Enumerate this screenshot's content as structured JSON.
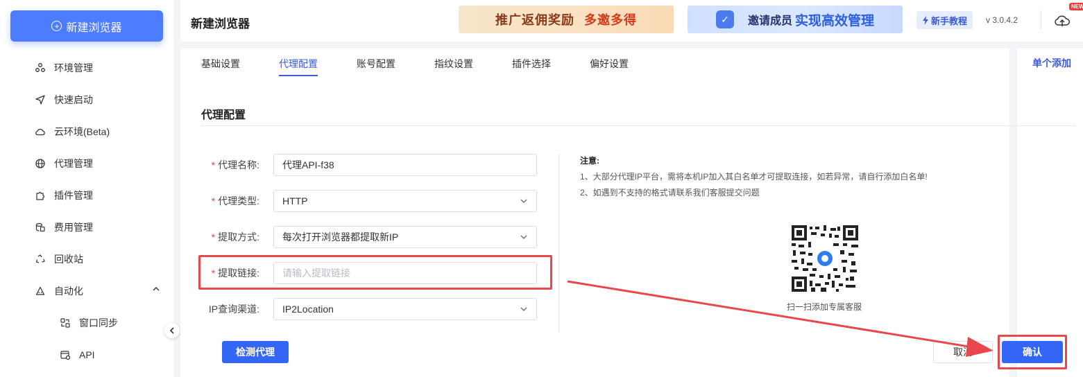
{
  "sidebar": {
    "new_browser_label": "新建浏览器",
    "items": [
      {
        "label": "环境管理",
        "icon": "cluster-icon"
      },
      {
        "label": "快速启动",
        "icon": "send-icon"
      },
      {
        "label": "云环境(Beta)",
        "icon": "cloud-icon"
      },
      {
        "label": "代理管理",
        "icon": "globe-icon"
      },
      {
        "label": "插件管理",
        "icon": "puzzle-icon"
      },
      {
        "label": "费用管理",
        "icon": "coins-icon"
      },
      {
        "label": "回收站",
        "icon": "recycle-icon"
      },
      {
        "label": "自动化",
        "icon": "robot-icon"
      }
    ],
    "sub_items": [
      {
        "label": "窗口同步",
        "icon": "window-sync-icon"
      },
      {
        "label": "API",
        "icon": "api-icon"
      }
    ]
  },
  "header": {
    "title": "新建浏览器",
    "banner1_a": "推广返佣奖励",
    "banner1_b": "多邀多得",
    "banner2_a": "邀请成员",
    "banner2_b": "实现高效管理",
    "tutorial": "新手教程",
    "version": "v 3.0.4.2",
    "new_badge": "NEW"
  },
  "tabs": [
    {
      "label": "基础设置",
      "active": false
    },
    {
      "label": "代理配置",
      "active": true
    },
    {
      "label": "账号配置",
      "active": false
    },
    {
      "label": "指纹设置",
      "active": false
    },
    {
      "label": "插件选择",
      "active": false
    },
    {
      "label": "偏好设置",
      "active": false
    }
  ],
  "right_panel": {
    "single_add": "单个添加"
  },
  "section_title": "代理配置",
  "form": {
    "proxy_name": {
      "label": "代理名称:",
      "value": "代理API-f38",
      "required": true
    },
    "proxy_type": {
      "label": "代理类型:",
      "value": "HTTP",
      "required": true
    },
    "extract_method": {
      "label": "提取方式:",
      "value": "每次打开浏览器都提取新IP",
      "required": true
    },
    "extract_link": {
      "label": "提取链接:",
      "placeholder": "请输入提取链接",
      "required": true
    },
    "ip_channel": {
      "label": "IP查询渠道:",
      "value": "IP2Location",
      "required": false
    }
  },
  "notice": {
    "title": "注意:",
    "line1": "1、大部分代理IP平台，需将本机IP加入其白名单才可提取连接，如若异常，请自行添加白名单!",
    "line2": "2、如遇到不支持的格式请联系我们客服提交问题"
  },
  "qr_caption": "扫一扫添加专属客服",
  "buttons": {
    "check_proxy": "检测代理",
    "cancel": "取消",
    "confirm": "确认"
  },
  "colors": {
    "accent": "#3466f5",
    "highlight_red": "#e8474b"
  }
}
